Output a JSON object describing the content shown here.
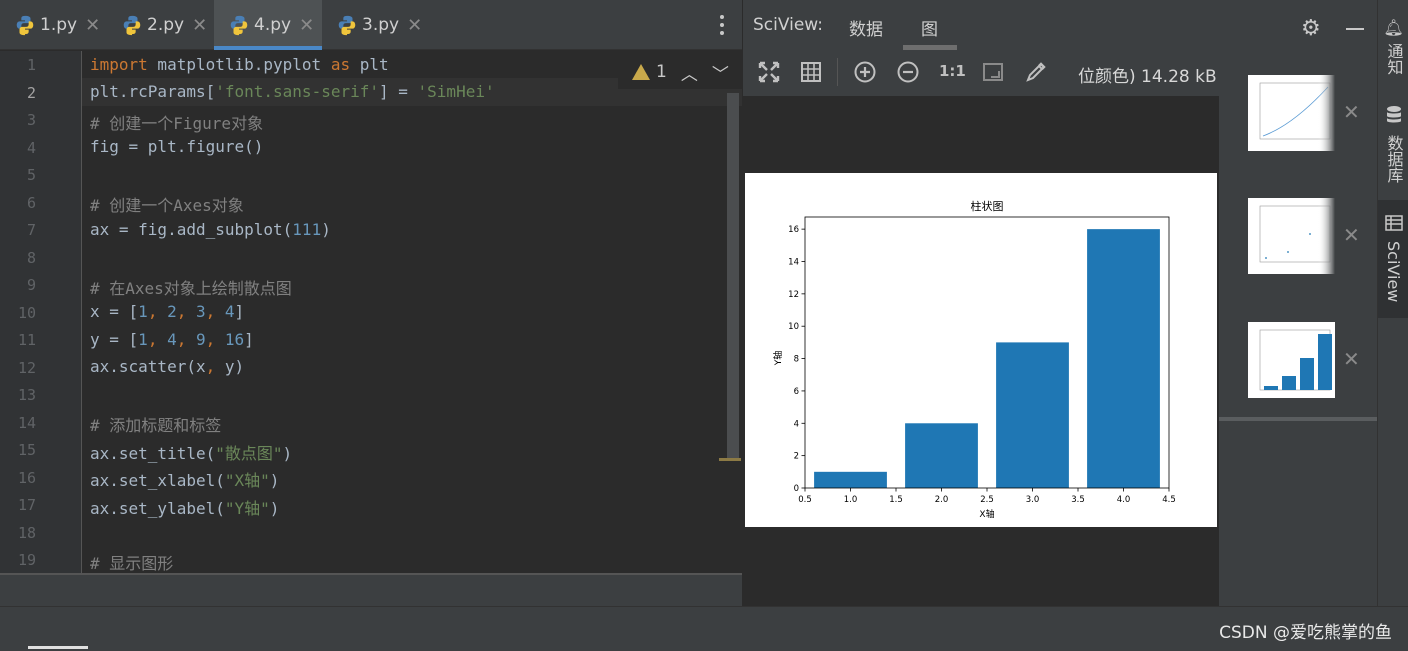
{
  "editor": {
    "tabs": [
      {
        "label": "1.py",
        "active": false
      },
      {
        "label": "2.py",
        "active": false
      },
      {
        "label": "4.py",
        "active": true
      },
      {
        "label": "3.py",
        "active": false
      }
    ],
    "warning_count": "1",
    "current_line": 2,
    "line_numbers": [
      "1",
      "2",
      "3",
      "4",
      "5",
      "6",
      "7",
      "8",
      "9",
      "10",
      "11",
      "12",
      "13",
      "14",
      "15",
      "16",
      "17",
      "18",
      "19"
    ]
  },
  "sciview": {
    "title": "SciView:",
    "tabs": [
      "数据",
      "图"
    ],
    "active_tab": "图",
    "image_info": "位颜色) 14.28 kB",
    "zoom_actual_label": "1:1"
  },
  "right_tools": [
    "通知",
    "数据库",
    "SciView"
  ],
  "watermark": "CSDN @爱吃熊掌的鱼",
  "colors": {
    "accent": "#4a88c7",
    "bar": "#1f77b4",
    "keyword": "#cc7832",
    "string": "#6a8759",
    "number": "#6897bb",
    "comment": "#808080"
  },
  "chart_data": {
    "type": "bar",
    "title": "柱状图",
    "xlabel": "X轴",
    "ylabel": "Y轴",
    "x": [
      1,
      2,
      3,
      4
    ],
    "values": [
      1,
      4,
      9,
      16
    ],
    "xlim": [
      0.5,
      4.5
    ],
    "ylim": [
      0,
      16.75
    ],
    "xticks": [
      "0.5",
      "1.0",
      "1.5",
      "2.0",
      "2.5",
      "3.0",
      "3.5",
      "4.0",
      "4.5"
    ],
    "yticks": [
      "0",
      "2",
      "4",
      "6",
      "8",
      "10",
      "12",
      "14",
      "16"
    ]
  }
}
